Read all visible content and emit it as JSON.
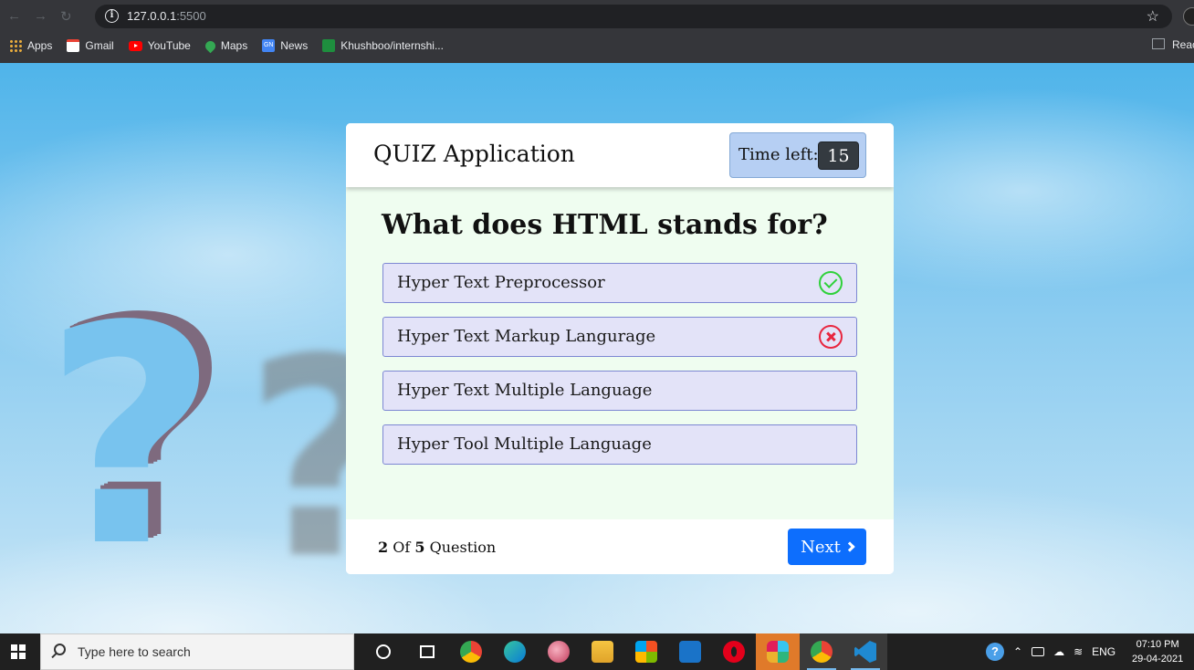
{
  "browser": {
    "url_host": "127.0.0.1",
    "url_port": ":5500",
    "bookmarks": [
      {
        "label": "Apps",
        "icon": "apps-icon"
      },
      {
        "label": "Gmail",
        "icon": "gmail-icon"
      },
      {
        "label": "YouTube",
        "icon": "youtube-icon"
      },
      {
        "label": "Maps",
        "icon": "maps-icon"
      },
      {
        "label": "News",
        "icon": "news-icon"
      },
      {
        "label": "Khushboo/internshi...",
        "icon": "github-icon"
      }
    ],
    "reading_list_label": "Reac"
  },
  "quiz": {
    "title": "QUIZ Application",
    "timer_label": "Time left:",
    "timer_value": "15",
    "question": "What does HTML stands for?",
    "options": [
      {
        "text": "Hyper Text Preprocessor",
        "status": "correct"
      },
      {
        "text": "Hyper Text Markup Langurage",
        "status": "incorrect"
      },
      {
        "text": "Hyper Text Multiple Language",
        "status": "none"
      },
      {
        "text": "Hyper Tool Multiple Language",
        "status": "none"
      }
    ],
    "counter_current": "2",
    "counter_of": "Of",
    "counter_total": "5",
    "counter_suffix": "Question",
    "next_label": "Next"
  },
  "taskbar": {
    "search_placeholder": "Type here to search",
    "language": "ENG",
    "time": "07:10 PM",
    "date": "29-04-2021",
    "apps": [
      "cortana-icon",
      "task-view-icon",
      "chrome-icon",
      "edge-icon",
      "paint-icon",
      "file-explorer-icon",
      "store-icon",
      "mail-icon",
      "opera-icon",
      "slack-icon",
      "chrome-profile-icon",
      "vscode-icon"
    ]
  },
  "colors": {
    "next_button": "#0d6efd",
    "timer_bg": "#b6cff3",
    "option_bg": "#e3e3f8",
    "correct": "#2fd13a",
    "incorrect": "#e8263f",
    "body_bg": "#effdf0"
  }
}
